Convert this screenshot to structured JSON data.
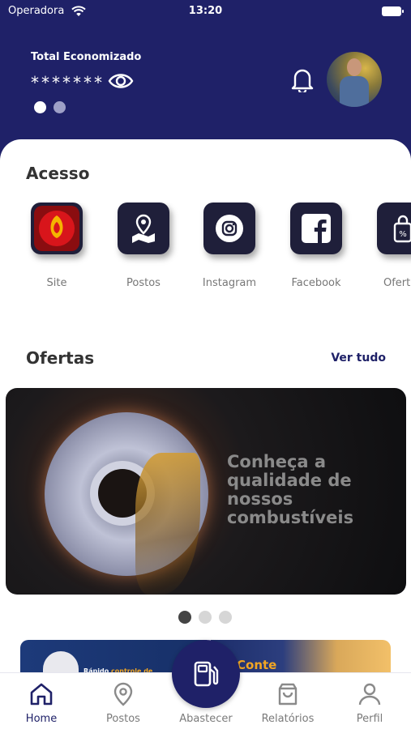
{
  "status_bar": {
    "carrier": "Operadora",
    "time": "13:20"
  },
  "header": {
    "total_label": "Total Economizado",
    "total_value": "*******"
  },
  "acesso": {
    "title": "Acesso",
    "items": [
      {
        "label": "Site",
        "icon": "site-logo-icon"
      },
      {
        "label": "Postos",
        "icon": "map-pin-icon"
      },
      {
        "label": "Instagram",
        "icon": "instagram-icon"
      },
      {
        "label": "Facebook",
        "icon": "facebook-icon"
      },
      {
        "label": "Ofertas",
        "icon": "offers-icon"
      }
    ]
  },
  "ofertas": {
    "title": "Ofertas",
    "see_all": "Ver tudo",
    "banner_text": "Conheça a qualidade de nossos combustíveis",
    "mini_left_text_a": "Rápido ",
    "mini_left_text_b": "controle de",
    "mini_right_text": "Conte"
  },
  "nav": {
    "home": "Home",
    "postos": "Postos",
    "abastecer": "Abastecer",
    "relatorios": "Relatórios",
    "perfil": "Perfil"
  },
  "colors": {
    "primary": "#1f2168",
    "accent_red": "#d8151b"
  }
}
